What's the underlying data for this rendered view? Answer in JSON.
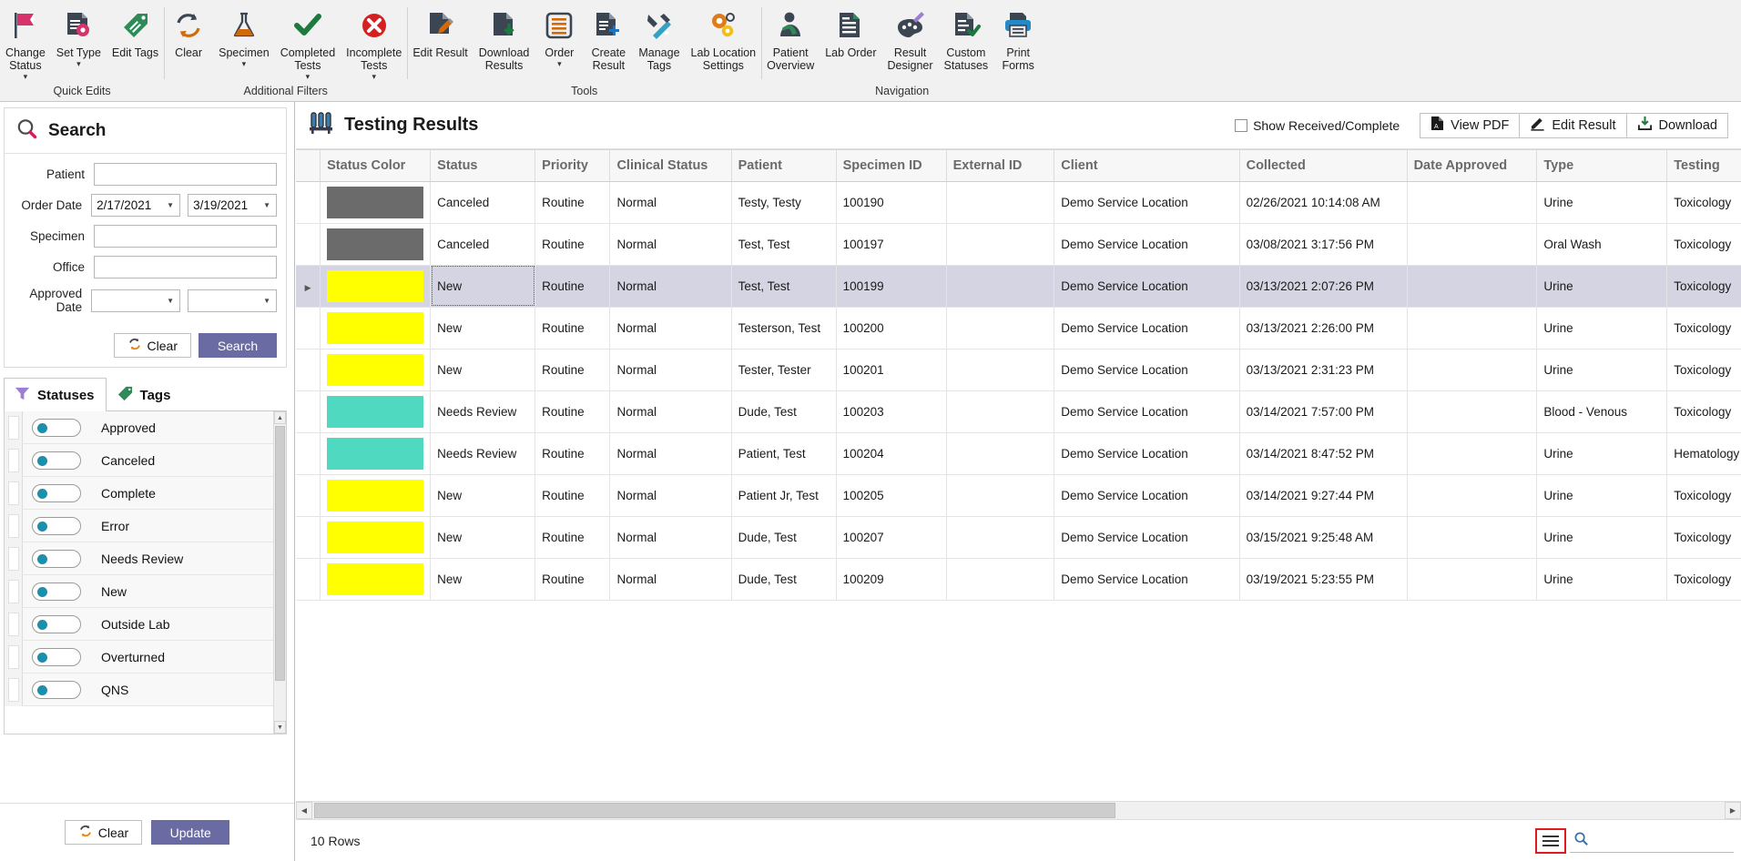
{
  "ribbon": {
    "groups": [
      {
        "title": "Quick Edits",
        "items": [
          {
            "label": "Change\nStatus",
            "icon": "flag-icon",
            "caret": true
          },
          {
            "label": "Set Type",
            "icon": "document-settings-icon",
            "caret": true
          },
          {
            "label": "Edit Tags",
            "icon": "tag-icon",
            "caret": false
          }
        ]
      },
      {
        "title": "Additional Filters",
        "items": [
          {
            "label": "Clear",
            "icon": "refresh-icon",
            "caret": false
          },
          {
            "label": "Specimen",
            "icon": "flask-icon",
            "caret": true
          },
          {
            "label": "Completed\nTests",
            "icon": "check-icon",
            "caret": true
          },
          {
            "label": "Incomplete\nTests",
            "icon": "error-circle-icon",
            "caret": true
          }
        ]
      },
      {
        "title": "Tools",
        "items": [
          {
            "label": "Edit Result",
            "icon": "document-pencil-icon",
            "caret": false
          },
          {
            "label": "Download\nResults",
            "icon": "document-download-icon",
            "caret": false
          },
          {
            "label": "Order",
            "icon": "list-order-icon",
            "caret": true
          },
          {
            "label": "Create\nResult",
            "icon": "document-plus-icon",
            "caret": false
          },
          {
            "label": "Manage\nTags",
            "icon": "tools-icon",
            "caret": false
          },
          {
            "label": "Lab Location\nSettings",
            "icon": "gears-icon",
            "caret": false
          }
        ]
      },
      {
        "title": "Navigation",
        "items": [
          {
            "label": "Patient\nOverview",
            "icon": "patient-icon",
            "caret": false
          },
          {
            "label": "Lab Order",
            "icon": "document-lines-icon",
            "caret": false
          },
          {
            "label": "Result\nDesigner",
            "icon": "palette-brush-icon",
            "caret": false
          },
          {
            "label": "Custom\nStatuses",
            "icon": "document-check-icon",
            "caret": false
          },
          {
            "label": "Print\nForms",
            "icon": "printer-icon",
            "caret": false
          }
        ]
      }
    ]
  },
  "search": {
    "title": "Search",
    "fields": {
      "patient_label": "Patient",
      "patient_value": "",
      "order_date_label": "Order Date",
      "order_date_from": "2/17/2021",
      "order_date_to": "3/19/2021",
      "specimen_label": "Specimen",
      "specimen_value": "",
      "office_label": "Office",
      "office_value": "",
      "approved_date_label": "Approved Date",
      "approved_date_from": "",
      "approved_date_to": ""
    },
    "clear_label": "Clear",
    "search_label": "Search"
  },
  "filter_tabs": [
    {
      "label": "Statuses",
      "icon": "funnel-icon",
      "active": true
    },
    {
      "label": "Tags",
      "icon": "tag-icon",
      "active": false
    }
  ],
  "statuses": [
    {
      "label": "Approved",
      "on": false
    },
    {
      "label": "Canceled",
      "on": false
    },
    {
      "label": "Complete",
      "on": false
    },
    {
      "label": "Error",
      "on": false
    },
    {
      "label": "Needs Review",
      "on": false
    },
    {
      "label": "New",
      "on": false
    },
    {
      "label": "Outside Lab",
      "on": false
    },
    {
      "label": "Overturned",
      "on": false
    },
    {
      "label": "QNS",
      "on": false
    }
  ],
  "left_footer": {
    "clear_label": "Clear",
    "update_label": "Update"
  },
  "main": {
    "title": "Testing Results",
    "title_icon": "test-tubes-icon",
    "show_received_label": "Show Received/Complete",
    "show_received_checked": false,
    "buttons": [
      {
        "label": "View PDF",
        "icon": "pdf-icon"
      },
      {
        "label": "Edit Result",
        "icon": "pencil-icon"
      },
      {
        "label": "Download",
        "icon": "download-icon"
      }
    ]
  },
  "table": {
    "columns": [
      "Status Color",
      "Status",
      "Priority",
      "Clinical Status",
      "Patient",
      "Specimen ID",
      "External ID",
      "Client",
      "Collected",
      "Date Approved",
      "Type",
      "Testing"
    ],
    "rows": [
      {
        "color": "#6b6b6b",
        "status": "Canceled",
        "priority": "Routine",
        "clinical_status": "Normal",
        "patient": "Testy, Testy",
        "specimen_id": "100190",
        "external_id": "",
        "client": "Demo Service Location",
        "collected": "02/26/2021 10:14:08 AM",
        "date_approved": "",
        "type": "Urine",
        "testing": "Toxicology",
        "selected": false
      },
      {
        "color": "#6b6b6b",
        "status": "Canceled",
        "priority": "Routine",
        "clinical_status": "Normal",
        "patient": "Test, Test",
        "specimen_id": "100197",
        "external_id": "",
        "client": "Demo Service Location",
        "collected": "03/08/2021 3:17:56 PM",
        "date_approved": "",
        "type": "Oral Wash",
        "testing": "Toxicology",
        "selected": false
      },
      {
        "color": "#ffff00",
        "status": "New",
        "priority": "Routine",
        "clinical_status": "Normal",
        "patient": "Test, Test",
        "specimen_id": "100199",
        "external_id": "",
        "client": "Demo Service Location",
        "collected": "03/13/2021 2:07:26 PM",
        "date_approved": "",
        "type": "Urine",
        "testing": "Toxicology",
        "selected": true
      },
      {
        "color": "#ffff00",
        "status": "New",
        "priority": "Routine",
        "clinical_status": "Normal",
        "patient": "Testerson, Test",
        "specimen_id": "100200",
        "external_id": "",
        "client": "Demo Service Location",
        "collected": "03/13/2021 2:26:00 PM",
        "date_approved": "",
        "type": "Urine",
        "testing": "Toxicology",
        "selected": false
      },
      {
        "color": "#ffff00",
        "status": "New",
        "priority": "Routine",
        "clinical_status": "Normal",
        "patient": "Tester, Tester",
        "specimen_id": "100201",
        "external_id": "",
        "client": "Demo Service Location",
        "collected": "03/13/2021 2:31:23 PM",
        "date_approved": "",
        "type": "Urine",
        "testing": "Toxicology",
        "selected": false
      },
      {
        "color": "#4fd9c0",
        "status": "Needs Review",
        "priority": "Routine",
        "clinical_status": "Normal",
        "patient": "Dude, Test",
        "specimen_id": "100203",
        "external_id": "",
        "client": "Demo Service Location",
        "collected": "03/14/2021 7:57:00 PM",
        "date_approved": "",
        "type": "Blood - Venous",
        "testing": "Toxicology",
        "selected": false
      },
      {
        "color": "#4fd9c0",
        "status": "Needs Review",
        "priority": "Routine",
        "clinical_status": "Normal",
        "patient": "Patient, Test",
        "specimen_id": "100204",
        "external_id": "",
        "client": "Demo Service Location",
        "collected": "03/14/2021 8:47:52 PM",
        "date_approved": "",
        "type": "Urine",
        "testing": "Hematology",
        "selected": false
      },
      {
        "color": "#ffff00",
        "status": "New",
        "priority": "Routine",
        "clinical_status": "Normal",
        "patient": "Patient Jr, Test",
        "specimen_id": "100205",
        "external_id": "",
        "client": "Demo Service Location",
        "collected": "03/14/2021 9:27:44 PM",
        "date_approved": "",
        "type": "Urine",
        "testing": "Toxicology",
        "selected": false
      },
      {
        "color": "#ffff00",
        "status": "New",
        "priority": "Routine",
        "clinical_status": "Normal",
        "patient": "Dude, Test",
        "specimen_id": "100207",
        "external_id": "",
        "client": "Demo Service Location",
        "collected": "03/15/2021 9:25:48 AM",
        "date_approved": "",
        "type": "Urine",
        "testing": "Toxicology",
        "selected": false
      },
      {
        "color": "#ffff00",
        "status": "New",
        "priority": "Routine",
        "clinical_status": "Normal",
        "patient": "Dude, Test",
        "specimen_id": "100209",
        "external_id": "",
        "client": "Demo Service Location",
        "collected": "03/19/2021 5:23:55 PM",
        "date_approved": "",
        "type": "Urine",
        "testing": "Toxicology",
        "selected": false
      }
    ]
  },
  "statusbar": {
    "rows_label": "10 Rows",
    "search_value": ""
  },
  "colors": {
    "accent": "#6b6ba3",
    "highlight_red": "#e01b1b",
    "selection": "#d4d4e2",
    "status_canceled": "#6b6b6b",
    "status_new": "#ffff00",
    "status_needs_review": "#4fd9c0"
  }
}
